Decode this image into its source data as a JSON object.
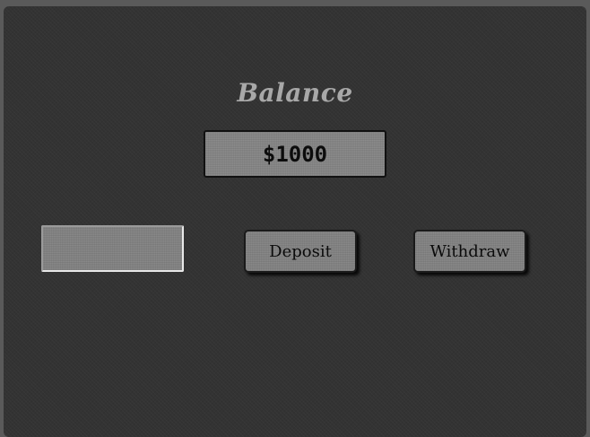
{
  "header": {
    "title": "Balance"
  },
  "balance": {
    "display": "$1000"
  },
  "amount_input": {
    "value": "",
    "placeholder": ""
  },
  "actions": {
    "deposit_label": "Deposit",
    "withdraw_label": "Withdraw"
  },
  "colors": {
    "background": "#333333",
    "title": "#a8a8a8",
    "control_fill": "#828282",
    "control_border": "#1a1a1a"
  }
}
